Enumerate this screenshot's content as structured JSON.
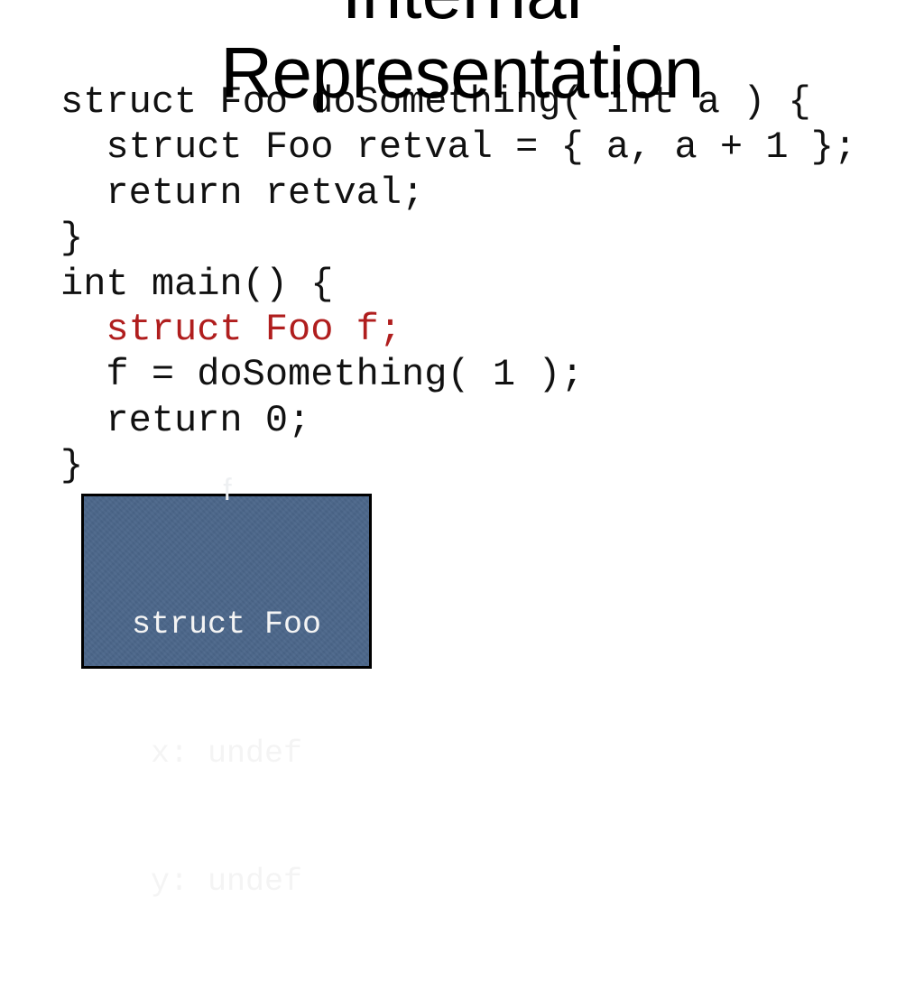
{
  "slide": {
    "title_line1": "Internal",
    "title_line2": "Representation",
    "code_lines": [
      {
        "text": "struct Foo doSomething( int a ) {",
        "highlight": false
      },
      {
        "text": "  struct Foo retval = { a, a + 1 };",
        "highlight": false
      },
      {
        "text": "  return retval;",
        "highlight": false
      },
      {
        "text": "}",
        "highlight": false
      },
      {
        "text": "int main() {",
        "highlight": false
      },
      {
        "text": "  struct Foo f;",
        "highlight": true
      },
      {
        "text": "  f = doSomething( 1 );",
        "highlight": false
      },
      {
        "text": "  return 0;",
        "highlight": false
      },
      {
        "text": "}",
        "highlight": false
      }
    ],
    "highlight_color": "#b01e1e",
    "memory_box": {
      "variable_label": "f",
      "type_label": "struct Foo",
      "fields": [
        "x: undef",
        "y: undef"
      ],
      "fill_color": "#4b668a"
    }
  }
}
